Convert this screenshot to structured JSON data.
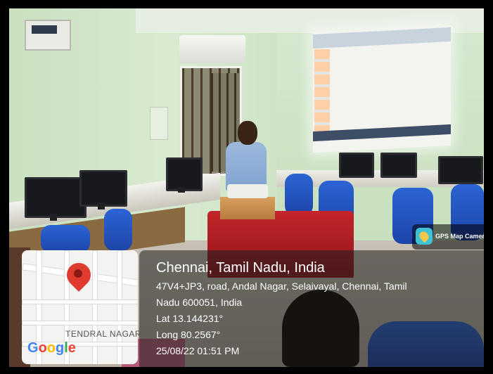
{
  "gps_tag": {
    "label": "GPS Map Camera",
    "icon": "gps-map-camera-icon"
  },
  "map": {
    "area_label": "TENDRAL NAGAR",
    "logo_text": [
      "G",
      "o",
      "o",
      "g",
      "l",
      "e"
    ],
    "logo_colors": [
      "#4285F4",
      "#EA4335",
      "#FBBC05",
      "#4285F4",
      "#34A853",
      "#EA4335"
    ],
    "pin_icon": "map-pin-icon"
  },
  "location": {
    "title": "Chennai, Tamil Nadu, India",
    "address_line1": "47V4+JP3, road, Andal Nagar, Selaivayal, Chennai, Tamil",
    "address_line2": "Nadu 600051, India",
    "lat": "Lat 13.144231°",
    "long": "Long 80.2567°",
    "datetime": "25/08/22 01:51 PM"
  }
}
